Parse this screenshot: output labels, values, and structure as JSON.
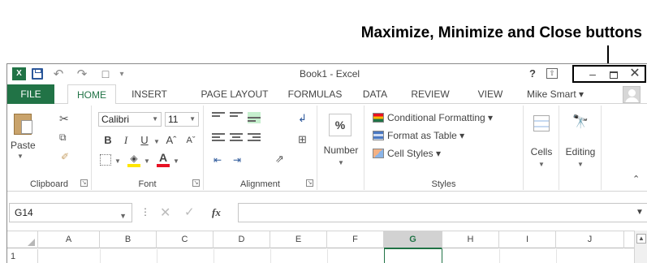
{
  "annotation": {
    "caption": "Maximize, Minimize and Close buttons"
  },
  "titlebar": {
    "app_icon_letter": "X",
    "title": "Book1 - Excel",
    "help": "?",
    "undo": "↶",
    "redo": "↷",
    "qa_more": "▾",
    "minimize": "–",
    "close": "✕"
  },
  "tabs": [
    "FILE",
    "HOME",
    "INSERT",
    "PAGE LAYOUT",
    "FORMULAS",
    "DATA",
    "REVIEW",
    "VIEW"
  ],
  "user": {
    "name": "Mike Smart ▾"
  },
  "ribbon": {
    "clipboard": {
      "label": "Clipboard",
      "paste": "Paste"
    },
    "font": {
      "label": "Font",
      "name": "Calibri",
      "size": "11",
      "bold": "B",
      "italic": "I",
      "underline": "U",
      "grow": "Aˆ",
      "shrink": "Aˇ",
      "fill": "◈",
      "color": "A"
    },
    "alignment": {
      "label": "Alignment"
    },
    "number": {
      "label": "Number",
      "symbol": "%"
    },
    "styles": {
      "label": "Styles",
      "conditional": "Conditional Formatting ▾",
      "table": "Format as Table ▾",
      "cell_styles": "Cell Styles ▾"
    },
    "cells": {
      "label": "Cells"
    },
    "editing": {
      "label": "Editing",
      "icon": "🔭"
    }
  },
  "formula_bar": {
    "name_box": "G14",
    "fx": "fx",
    "cancel": "✕",
    "enter": "✓"
  },
  "grid": {
    "columns": [
      "A",
      "B",
      "C",
      "D",
      "E",
      "F",
      "G",
      "H",
      "I",
      "J"
    ],
    "selected_column": "G",
    "first_row": "1"
  },
  "colors": {
    "accent": "#217346",
    "selected_header": "#d2d2d2"
  }
}
